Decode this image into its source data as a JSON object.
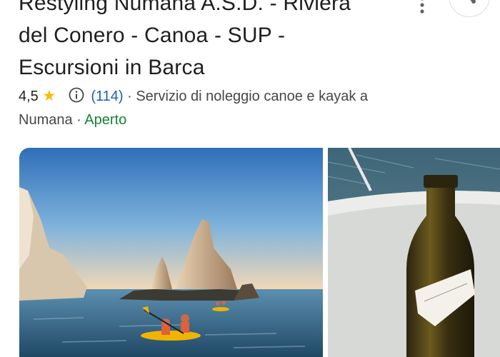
{
  "place": {
    "title_lines": [
      "Restyling Numana A.S.D. - Riviera",
      "del Conero - Canoa - SUP -",
      "Escursioni in Barca"
    ],
    "rating": "4,5",
    "review_count": "(114)",
    "separator": "·",
    "category": "Servizio di noleggio canoe e kayak a",
    "location": "Numana",
    "status": "Aperto"
  },
  "icons": {
    "star": "star-icon",
    "info": "info-icon",
    "more": "more-vert-icon",
    "share": "share-icon"
  },
  "photos": [
    {
      "subject": "kayak-sea-rocks-photo"
    },
    {
      "subject": "wine-bottle-boat-photo"
    }
  ],
  "colors": {
    "title": "#1f1f1f",
    "link": "#1a5fb4",
    "open": "#188038",
    "star": "#fbbc04"
  }
}
